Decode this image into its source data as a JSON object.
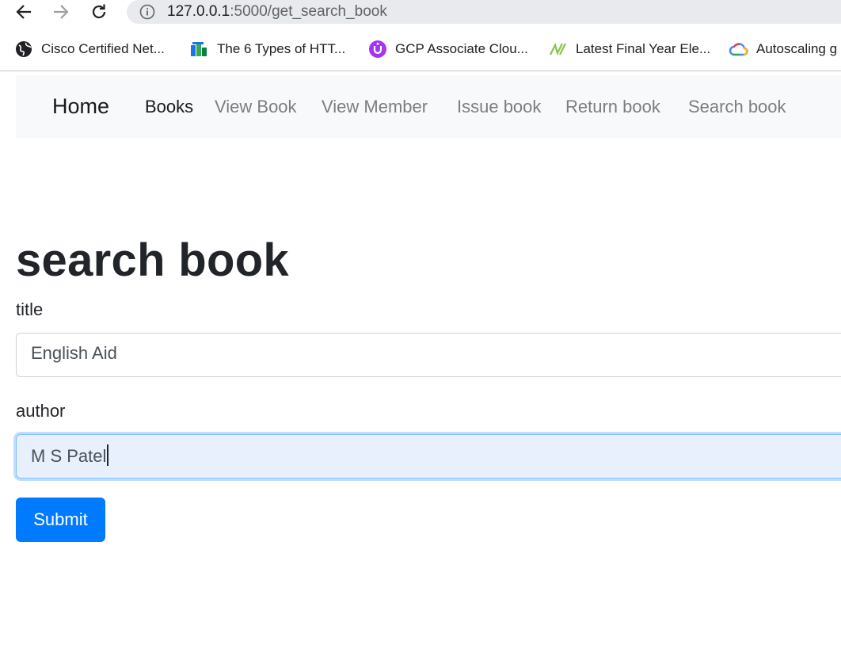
{
  "browser": {
    "url_host": "127.0.0.1",
    "url_path": ":5000/get_search_book",
    "bookmarks": [
      {
        "label": "Cisco Certified Net...",
        "icon": "globe-icon"
      },
      {
        "label": "The 6 Types of HTT...",
        "icon": "bars-logo-icon"
      },
      {
        "label": "GCP Associate Clou...",
        "icon": "purple-u-icon"
      },
      {
        "label": "Latest Final Year Ele...",
        "icon": "green-n-icon"
      },
      {
        "label": "Autoscaling g",
        "icon": "google-cloud-icon"
      }
    ]
  },
  "navbar": {
    "brand": "Home",
    "links": [
      {
        "label": "Books"
      },
      {
        "label": "View Book"
      },
      {
        "label": "View Member"
      },
      {
        "label": "Issue book"
      },
      {
        "label": "Return book"
      },
      {
        "label": "Search book"
      }
    ]
  },
  "form": {
    "title": "search book",
    "fields": [
      {
        "label": "title",
        "value": "English Aid"
      },
      {
        "label": "author",
        "value": "M S Patel"
      }
    ],
    "submit_label": "Submit"
  },
  "colors": {
    "primary": "#007bff",
    "navbar_bg": "#f8f9fa",
    "focused_input_bg": "#e8f0fe"
  }
}
